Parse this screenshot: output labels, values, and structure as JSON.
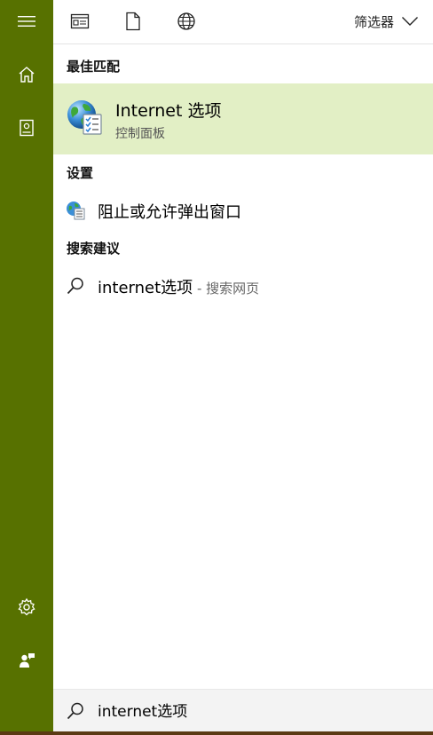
{
  "rail": {
    "menu_icon": "hamburger-menu-icon",
    "home_icon": "home-icon",
    "notebook_icon": "notebook-icon",
    "settings_icon": "gear-icon",
    "feedback_icon": "feedback-person-icon"
  },
  "toolbar": {
    "apps_icon": "apps-window-icon",
    "documents_icon": "document-icon",
    "web_icon": "globe-icon",
    "filter_label": "筛选器",
    "filter_icon": "chevron-down-icon"
  },
  "sections": {
    "best_match": "最佳匹配",
    "settings": "设置",
    "suggestions": "搜索建议"
  },
  "best_match": {
    "title": "Internet 选项",
    "subtitle": "控制面板",
    "icon": "internet-options-globe-icon"
  },
  "settings_results": [
    {
      "label": "阻止或允许弹出窗口",
      "icon": "internet-options-small-icon"
    }
  ],
  "suggestions": [
    {
      "label": "internet选项",
      "suffix": " - 搜索网页",
      "icon": "search-icon"
    }
  ],
  "search": {
    "value": "internet选项",
    "icon": "search-icon"
  },
  "colors": {
    "rail": "#577100",
    "highlight": "#e2efc5",
    "searchbar": "#f3f3f3"
  }
}
